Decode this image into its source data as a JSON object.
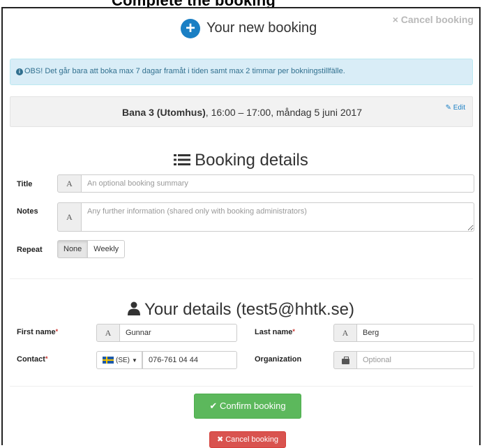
{
  "page_heading": "Complete the booking",
  "header": {
    "title": "Your new booking",
    "cancel_label": "× Cancel booking"
  },
  "info": {
    "text": "OBS! Det går bara att boka max 7 dagar framåt i tiden samt max 2 timmar per bokningstillfälle."
  },
  "summary": {
    "court": "Bana 3 (Utomhus)",
    "details": ", 16:00 – 17:00, måndag 5 juni 2017",
    "edit_label": "Edit"
  },
  "booking_details": {
    "heading": "Booking details",
    "title_label": "Title",
    "title_placeholder": "An optional booking summary",
    "notes_label": "Notes",
    "notes_placeholder": "Any further information (shared only with booking administrators)",
    "repeat_label": "Repeat",
    "repeat_options": [
      "None",
      "Weekly"
    ],
    "repeat_selected": "None",
    "addon_glyph": "A"
  },
  "your_details": {
    "heading": "Your details (test5@hhtk.se)",
    "first_name_label": "First name",
    "first_name_value": "Gunnar",
    "last_name_label": "Last name",
    "last_name_value": "Berg",
    "contact_label": "Contact",
    "country_code": "(SE)",
    "phone_value": "076-761 04 44",
    "organization_label": "Organization",
    "organization_placeholder": "Optional",
    "required_mark": "*"
  },
  "actions": {
    "confirm_label": "Confirm booking",
    "cancel_label": "Cancel booking"
  },
  "colors": {
    "primary": "#1a7fc4",
    "success": "#5cb85c",
    "danger": "#d9534f",
    "info_bg": "#d9edf7"
  }
}
